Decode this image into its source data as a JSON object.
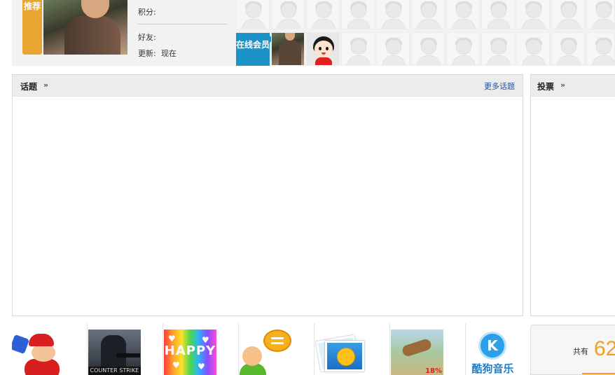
{
  "top": {
    "recommend_label": "推荐",
    "info": {
      "points_label": "积分:",
      "friends_label": "好友:",
      "update_label": "更新:",
      "update_value": "现在"
    },
    "online_label": "在线会员"
  },
  "topics_panel": {
    "title": "话题",
    "arrow": "»",
    "more_link": "更多话题"
  },
  "poll_panel": {
    "title": "投票",
    "arrow": "»"
  },
  "apps": [
    {
      "name": "mario-game-icon"
    },
    {
      "name": "counter-strike-icon",
      "caption": "COUNTER STRIKE"
    },
    {
      "name": "happy-icon",
      "caption": "HAPPY"
    },
    {
      "name": "chat-icon"
    },
    {
      "name": "photo-album-icon"
    },
    {
      "name": "deer-game-icon",
      "caption": "18%"
    },
    {
      "name": "kugou-music-icon",
      "caption": "酷狗音乐",
      "letter": "K"
    }
  ],
  "total": {
    "label": "共有",
    "count": "62"
  },
  "colors": {
    "recommend": "#e8a531",
    "online": "#1b93c8",
    "link": "#1f4f9e",
    "accent": "#f0a020"
  }
}
